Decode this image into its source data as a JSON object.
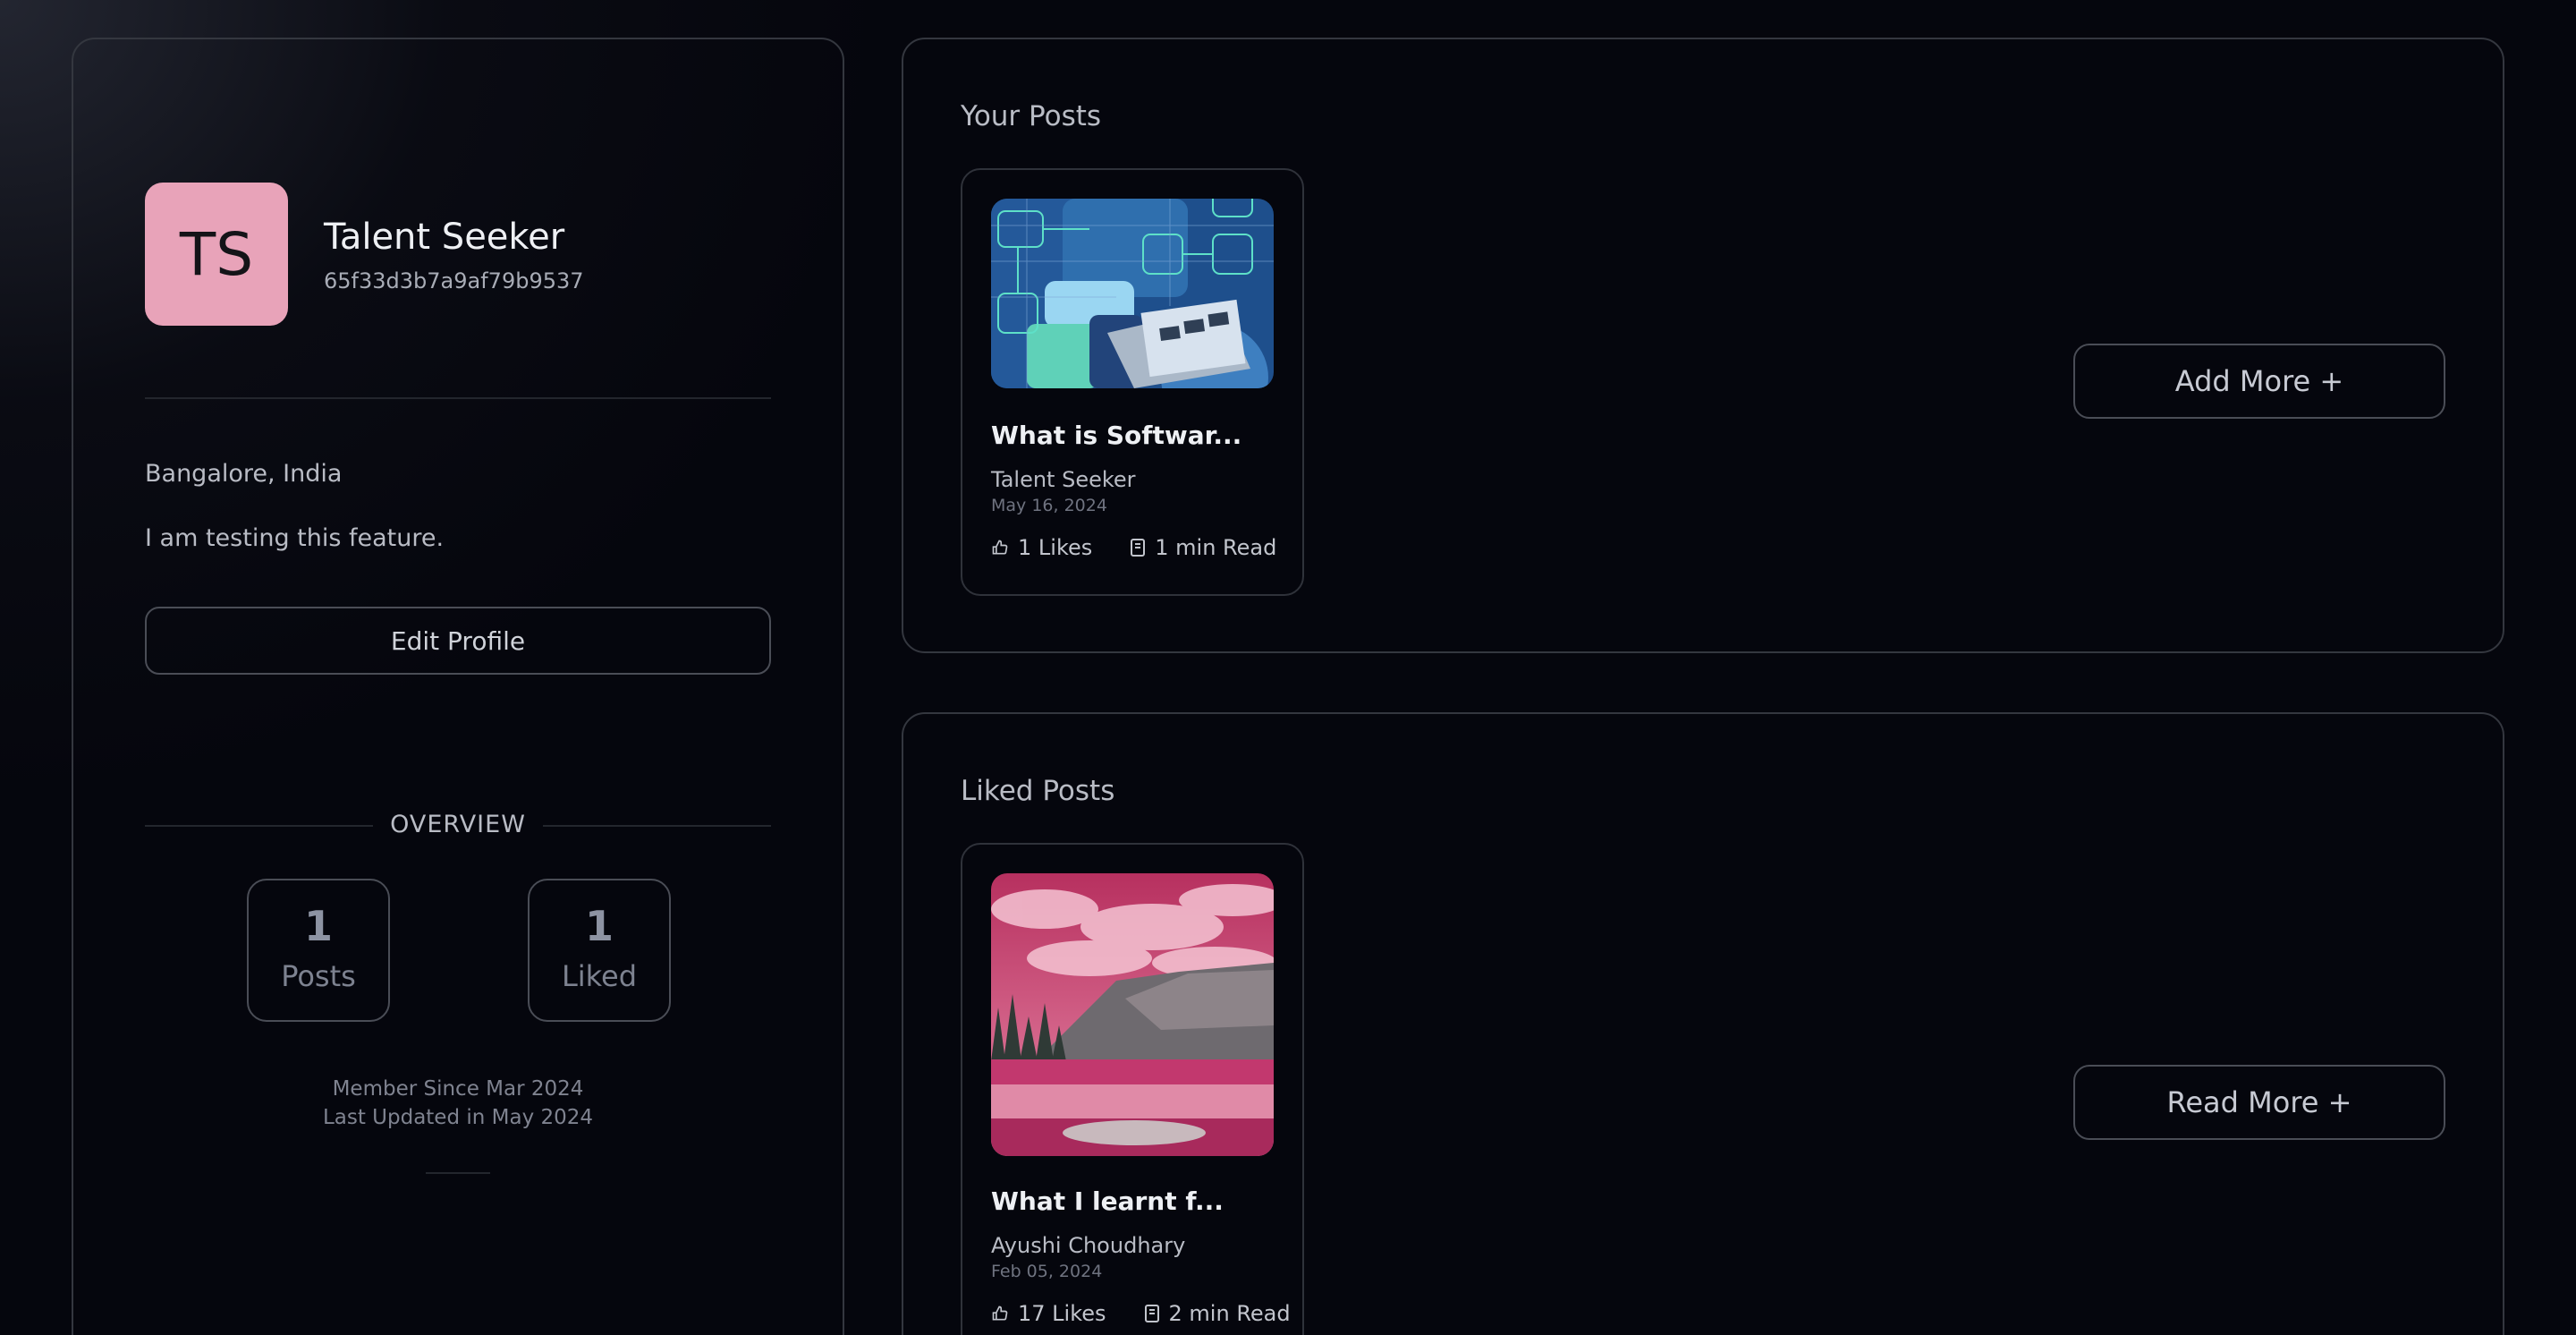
{
  "profile": {
    "initials": "TS",
    "name": "Talent Seeker",
    "id": "65f33d3b7a9af79b9537",
    "location": "Bangalore, India",
    "bio": "I am testing this feature.",
    "edit_label": "Edit Profile",
    "overview_label": "OVERVIEW",
    "stats": [
      {
        "value": "1",
        "label": "Posts"
      },
      {
        "value": "1",
        "label": "Liked"
      }
    ],
    "member_since": "Member Since Mar 2024",
    "last_updated": "Last Updated in May 2024"
  },
  "your_posts": {
    "title": "Your Posts",
    "button_label": "Add More +",
    "posts": [
      {
        "title": "What is Softwar...",
        "author": "Talent Seeker",
        "date": "May 16, 2024",
        "likes": "1 Likes",
        "read_time": "1 min Read"
      }
    ]
  },
  "liked_posts": {
    "title": "Liked Posts",
    "button_label": "Read More +",
    "posts": [
      {
        "title": "What I learnt f...",
        "author": "Ayushi Choudhary",
        "date": "Feb 05, 2024",
        "likes": "17 Likes",
        "read_time": "2 min Read"
      }
    ]
  },
  "colors": {
    "background": "#05060d",
    "avatar": "#e8a3b9",
    "border": "#34373f"
  },
  "icons": [
    "thumbs-up-icon",
    "document-icon"
  ]
}
